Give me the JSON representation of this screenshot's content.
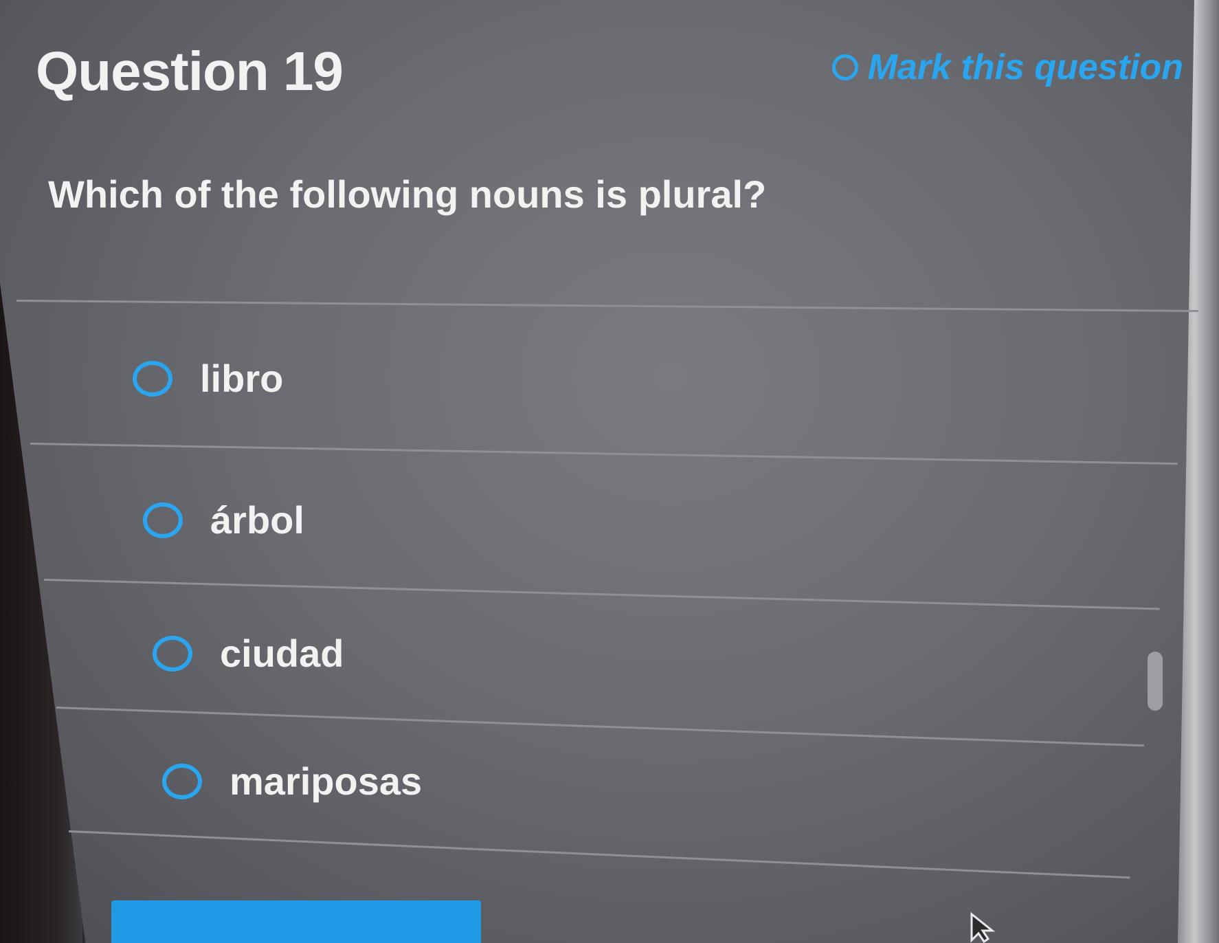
{
  "question": {
    "title": "Question 19",
    "mark_label": "Mark this question",
    "prompt": "Which of the following nouns is plural?"
  },
  "options": [
    {
      "label": "libro"
    },
    {
      "label": "árbol"
    },
    {
      "label": "ciudad"
    },
    {
      "label": "mariposas"
    }
  ],
  "colors": {
    "accent": "#2aa6f0",
    "button": "#1f9ae4",
    "text": "#f2f2f2"
  },
  "icons": {
    "mark": "radio-circle-icon",
    "option": "radio-circle-icon",
    "pointer": "arrow-cursor-icon"
  }
}
